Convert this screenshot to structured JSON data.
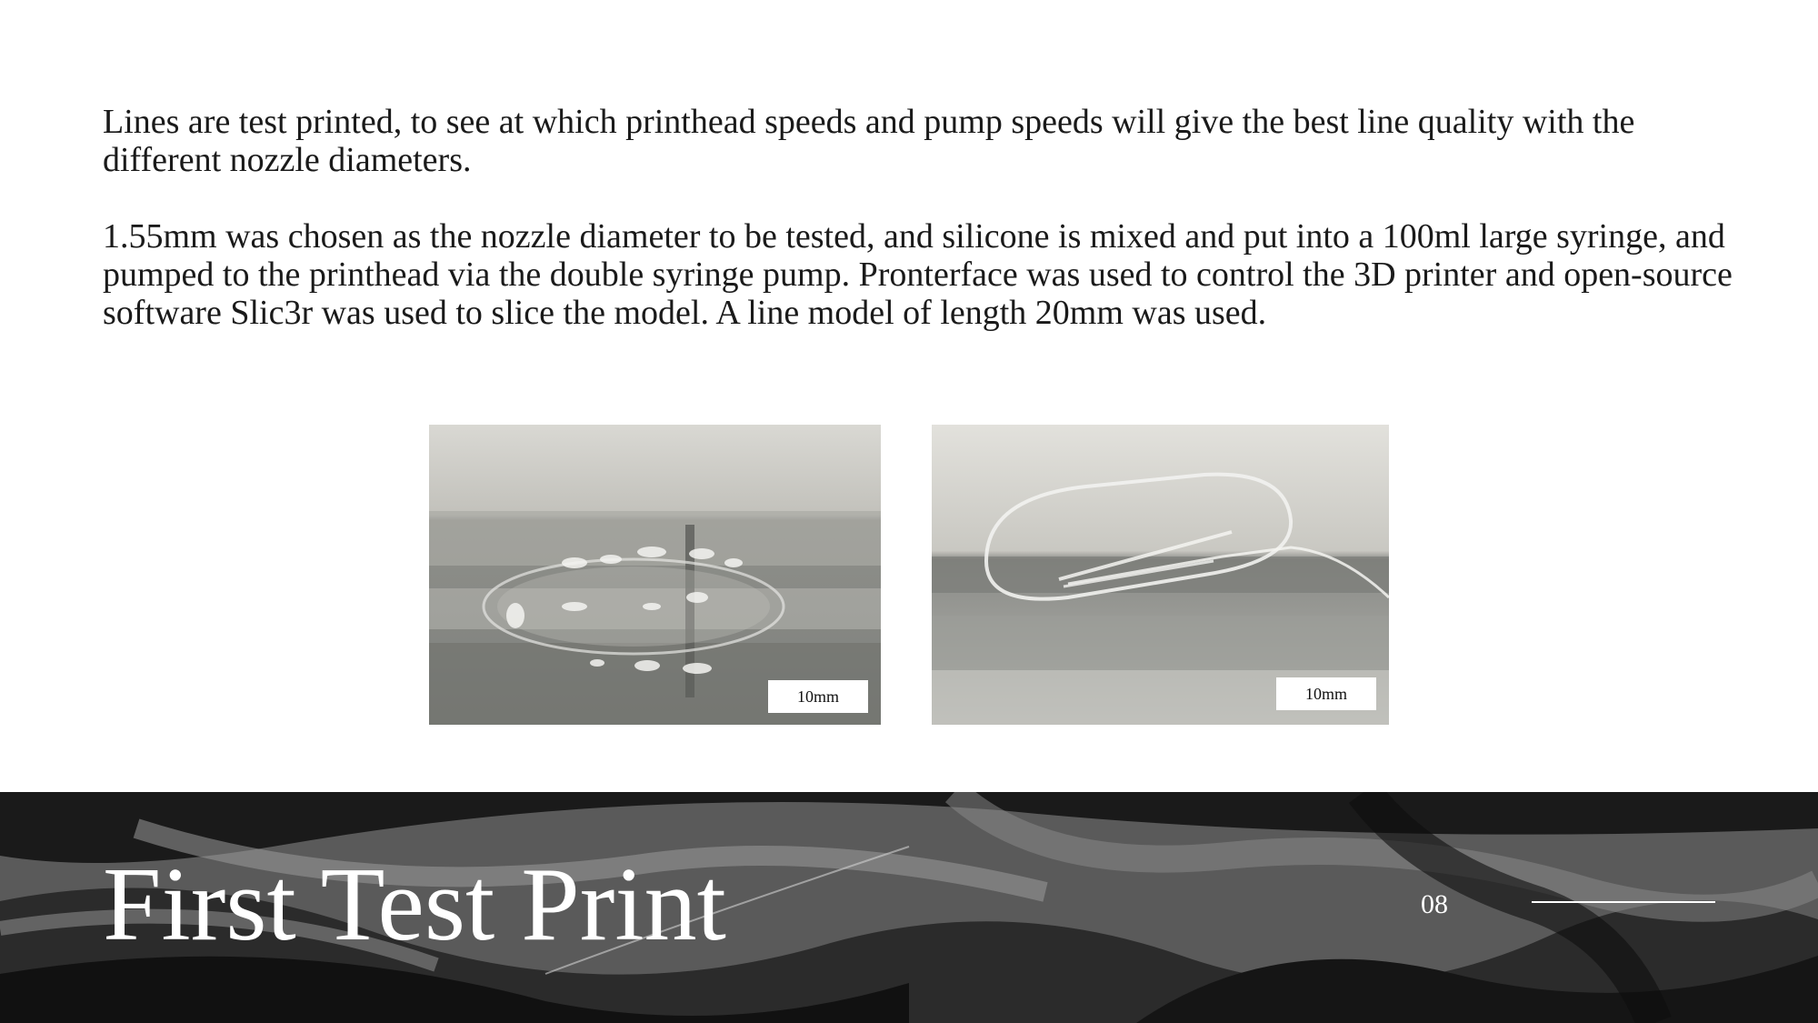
{
  "body": {
    "paragraph_1": "Lines are test printed, to see at which printhead speeds and pump speeds will give the best line quality with the different nozzle diameters.",
    "paragraph_2": "1.55mm was chosen as the nozzle diameter to be tested, and silicone is mixed and put into a 100ml large syringe, and pumped to the printhead via the double syringe pump. Pronterface was used to control the 3D printer and open-source software Slic3r was used to slice the model. A line model of length 20mm was used."
  },
  "figures": [
    {
      "scale_label": "10mm"
    },
    {
      "scale_label": "10mm"
    }
  ],
  "footer": {
    "title": "First Test Print",
    "page_number": "08"
  }
}
